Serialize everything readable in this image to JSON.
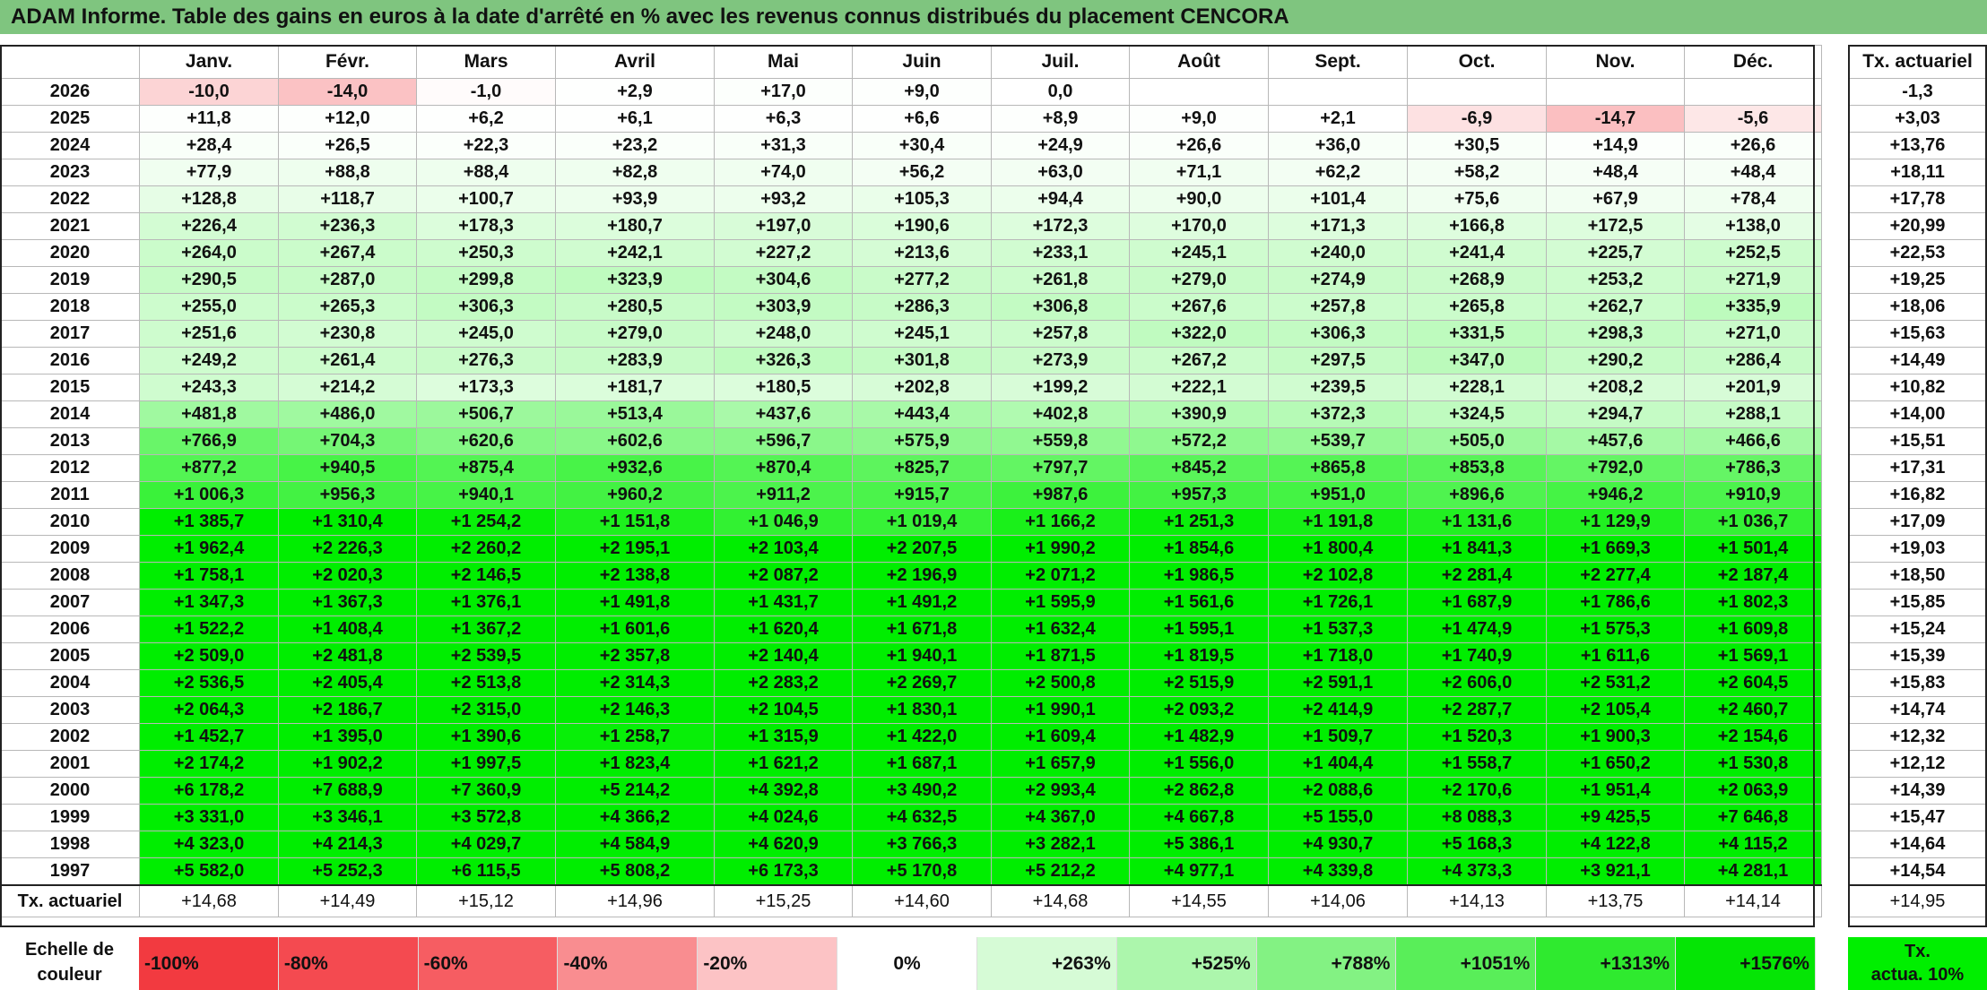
{
  "title": "ADAM Informe. Table des gains en euros à la date d'arrêté en % avec les revenus connus distribués du placement CENCORA",
  "months": [
    "Janv.",
    "Févr.",
    "Mars",
    "Avril",
    "Mai",
    "Juin",
    "Juil.",
    "Août",
    "Sept.",
    "Oct.",
    "Nov.",
    "Déc."
  ],
  "side_header": "Tx. actuariel",
  "rows": [
    {
      "year": "2026",
      "values": [
        "-10,0",
        "-14,0",
        "-1,0",
        "+2,9",
        "+17,0",
        "+9,0",
        "0,0",
        "",
        "",
        "",
        "",
        ""
      ],
      "tx": "-1,3"
    },
    {
      "year": "2025",
      "values": [
        "+11,8",
        "+12,0",
        "+6,2",
        "+6,1",
        "+6,3",
        "+6,6",
        "+8,9",
        "+9,0",
        "+2,1",
        "-6,9",
        "-14,7",
        "-5,6"
      ],
      "tx": "+3,03"
    },
    {
      "year": "2024",
      "values": [
        "+28,4",
        "+26,5",
        "+22,3",
        "+23,2",
        "+31,3",
        "+30,4",
        "+24,9",
        "+26,6",
        "+36,0",
        "+30,5",
        "+14,9",
        "+26,6"
      ],
      "tx": "+13,76"
    },
    {
      "year": "2023",
      "values": [
        "+77,9",
        "+88,8",
        "+88,4",
        "+82,8",
        "+74,0",
        "+56,2",
        "+63,0",
        "+71,1",
        "+62,2",
        "+58,2",
        "+48,4",
        "+48,4"
      ],
      "tx": "+18,11"
    },
    {
      "year": "2022",
      "values": [
        "+128,8",
        "+118,7",
        "+100,7",
        "+93,9",
        "+93,2",
        "+105,3",
        "+94,4",
        "+90,0",
        "+101,4",
        "+75,6",
        "+67,9",
        "+78,4"
      ],
      "tx": "+17,78"
    },
    {
      "year": "2021",
      "values": [
        "+226,4",
        "+236,3",
        "+178,3",
        "+180,7",
        "+197,0",
        "+190,6",
        "+172,3",
        "+170,0",
        "+171,3",
        "+166,8",
        "+172,5",
        "+138,0"
      ],
      "tx": "+20,99"
    },
    {
      "year": "2020",
      "values": [
        "+264,0",
        "+267,4",
        "+250,3",
        "+242,1",
        "+227,2",
        "+213,6",
        "+233,1",
        "+245,1",
        "+240,0",
        "+241,4",
        "+225,7",
        "+252,5"
      ],
      "tx": "+22,53"
    },
    {
      "year": "2019",
      "values": [
        "+290,5",
        "+287,0",
        "+299,8",
        "+323,9",
        "+304,6",
        "+277,2",
        "+261,8",
        "+279,0",
        "+274,9",
        "+268,9",
        "+253,2",
        "+271,9"
      ],
      "tx": "+19,25"
    },
    {
      "year": "2018",
      "values": [
        "+255,0",
        "+265,3",
        "+306,3",
        "+280,5",
        "+303,9",
        "+286,3",
        "+306,8",
        "+267,6",
        "+257,8",
        "+265,8",
        "+262,7",
        "+335,9"
      ],
      "tx": "+18,06"
    },
    {
      "year": "2017",
      "values": [
        "+251,6",
        "+230,8",
        "+245,0",
        "+279,0",
        "+248,0",
        "+245,1",
        "+257,8",
        "+322,0",
        "+306,3",
        "+331,5",
        "+298,3",
        "+271,0"
      ],
      "tx": "+15,63"
    },
    {
      "year": "2016",
      "values": [
        "+249,2",
        "+261,4",
        "+276,3",
        "+283,9",
        "+326,3",
        "+301,8",
        "+273,9",
        "+267,2",
        "+297,5",
        "+347,0",
        "+290,2",
        "+286,4"
      ],
      "tx": "+14,49"
    },
    {
      "year": "2015",
      "values": [
        "+243,3",
        "+214,2",
        "+173,3",
        "+181,7",
        "+180,5",
        "+202,8",
        "+199,2",
        "+222,1",
        "+239,5",
        "+228,1",
        "+208,2",
        "+201,9"
      ],
      "tx": "+10,82"
    },
    {
      "year": "2014",
      "values": [
        "+481,8",
        "+486,0",
        "+506,7",
        "+513,4",
        "+437,6",
        "+443,4",
        "+402,8",
        "+390,9",
        "+372,3",
        "+324,5",
        "+294,7",
        "+288,1"
      ],
      "tx": "+14,00"
    },
    {
      "year": "2013",
      "values": [
        "+766,9",
        "+704,3",
        "+620,6",
        "+602,6",
        "+596,7",
        "+575,9",
        "+559,8",
        "+572,2",
        "+539,7",
        "+505,0",
        "+457,6",
        "+466,6"
      ],
      "tx": "+15,51"
    },
    {
      "year": "2012",
      "values": [
        "+877,2",
        "+940,5",
        "+875,4",
        "+932,6",
        "+870,4",
        "+825,7",
        "+797,7",
        "+845,2",
        "+865,8",
        "+853,8",
        "+792,0",
        "+786,3"
      ],
      "tx": "+17,31"
    },
    {
      "year": "2011",
      "values": [
        "+1 006,3",
        "+956,3",
        "+940,1",
        "+960,2",
        "+911,2",
        "+915,7",
        "+987,6",
        "+957,3",
        "+951,0",
        "+896,6",
        "+946,2",
        "+910,9"
      ],
      "tx": "+16,82"
    },
    {
      "year": "2010",
      "values": [
        "+1 385,7",
        "+1 310,4",
        "+1 254,2",
        "+1 151,8",
        "+1 046,9",
        "+1 019,4",
        "+1 166,2",
        "+1 251,3",
        "+1 191,8",
        "+1 131,6",
        "+1 129,9",
        "+1 036,7"
      ],
      "tx": "+17,09"
    },
    {
      "year": "2009",
      "values": [
        "+1 962,4",
        "+2 226,3",
        "+2 260,2",
        "+2 195,1",
        "+2 103,4",
        "+2 207,5",
        "+1 990,2",
        "+1 854,6",
        "+1 800,4",
        "+1 841,3",
        "+1 669,3",
        "+1 501,4"
      ],
      "tx": "+19,03"
    },
    {
      "year": "2008",
      "values": [
        "+1 758,1",
        "+2 020,3",
        "+2 146,5",
        "+2 138,8",
        "+2 087,2",
        "+2 196,9",
        "+2 071,2",
        "+1 986,5",
        "+2 102,8",
        "+2 281,4",
        "+2 277,4",
        "+2 187,4"
      ],
      "tx": "+18,50"
    },
    {
      "year": "2007",
      "values": [
        "+1 347,3",
        "+1 367,3",
        "+1 376,1",
        "+1 491,8",
        "+1 431,7",
        "+1 491,2",
        "+1 595,9",
        "+1 561,6",
        "+1 726,1",
        "+1 687,9",
        "+1 786,6",
        "+1 802,3"
      ],
      "tx": "+15,85"
    },
    {
      "year": "2006",
      "values": [
        "+1 522,2",
        "+1 408,4",
        "+1 367,2",
        "+1 601,6",
        "+1 620,4",
        "+1 671,8",
        "+1 632,4",
        "+1 595,1",
        "+1 537,3",
        "+1 474,9",
        "+1 575,3",
        "+1 609,8"
      ],
      "tx": "+15,24"
    },
    {
      "year": "2005",
      "values": [
        "+2 509,0",
        "+2 481,8",
        "+2 539,5",
        "+2 357,8",
        "+2 140,4",
        "+1 940,1",
        "+1 871,5",
        "+1 819,5",
        "+1 718,0",
        "+1 740,9",
        "+1 611,6",
        "+1 569,1"
      ],
      "tx": "+15,39"
    },
    {
      "year": "2004",
      "values": [
        "+2 536,5",
        "+2 405,4",
        "+2 513,8",
        "+2 314,3",
        "+2 283,2",
        "+2 269,7",
        "+2 500,8",
        "+2 515,9",
        "+2 591,1",
        "+2 606,0",
        "+2 531,2",
        "+2 604,5"
      ],
      "tx": "+15,83"
    },
    {
      "year": "2003",
      "values": [
        "+2 064,3",
        "+2 186,7",
        "+2 315,0",
        "+2 146,3",
        "+2 104,5",
        "+1 830,1",
        "+1 990,1",
        "+2 093,2",
        "+2 414,9",
        "+2 287,7",
        "+2 105,4",
        "+2 460,7"
      ],
      "tx": "+14,74"
    },
    {
      "year": "2002",
      "values": [
        "+1 452,7",
        "+1 395,0",
        "+1 390,6",
        "+1 258,7",
        "+1 315,9",
        "+1 422,0",
        "+1 609,4",
        "+1 482,9",
        "+1 509,7",
        "+1 520,3",
        "+1 900,3",
        "+2 154,6"
      ],
      "tx": "+12,32"
    },
    {
      "year": "2001",
      "values": [
        "+2 174,2",
        "+1 902,2",
        "+1 997,5",
        "+1 823,4",
        "+1 621,2",
        "+1 687,1",
        "+1 657,9",
        "+1 556,0",
        "+1 404,4",
        "+1 558,7",
        "+1 650,2",
        "+1 530,8"
      ],
      "tx": "+12,12"
    },
    {
      "year": "2000",
      "values": [
        "+6 178,2",
        "+7 688,9",
        "+7 360,9",
        "+5 214,2",
        "+4 392,8",
        "+3 490,2",
        "+2 993,4",
        "+2 862,8",
        "+2 088,6",
        "+2 170,6",
        "+1 951,4",
        "+2 063,9"
      ],
      "tx": "+14,39"
    },
    {
      "year": "1999",
      "values": [
        "+3 331,0",
        "+3 346,1",
        "+3 572,8",
        "+4 366,2",
        "+4 024,6",
        "+4 632,5",
        "+4 367,0",
        "+4 667,8",
        "+5 155,0",
        "+8 088,3",
        "+9 425,5",
        "+7 646,8"
      ],
      "tx": "+15,47"
    },
    {
      "year": "1998",
      "values": [
        "+4 323,0",
        "+4 214,3",
        "+4 029,7",
        "+4 584,9",
        "+4 620,9",
        "+3 766,3",
        "+3 282,1",
        "+5 386,1",
        "+4 930,7",
        "+5 168,3",
        "+4 122,8",
        "+4 115,2"
      ],
      "tx": "+14,64"
    },
    {
      "year": "1997",
      "values": [
        "+5 582,0",
        "+5 252,3",
        "+6 115,5",
        "+5 808,2",
        "+6 173,3",
        "+5 170,8",
        "+5 212,2",
        "+4 977,1",
        "+4 339,8",
        "+4 373,3",
        "+3 921,1",
        "+4 281,1"
      ],
      "tx": "+14,54"
    }
  ],
  "footer": {
    "label": "Tx. actuariel",
    "values": [
      "+14,68",
      "+14,49",
      "+15,12",
      "+14,96",
      "+15,25",
      "+14,60",
      "+14,68",
      "+14,55",
      "+14,06",
      "+14,13",
      "+13,75",
      "+14,14"
    ],
    "tx": "+14,95"
  },
  "scale": {
    "label": "Echelle de couleur",
    "items": [
      {
        "text": "-100%",
        "color": "#f23a40",
        "align": "l"
      },
      {
        "text": "-80%",
        "color": "#f44a50",
        "align": "l"
      },
      {
        "text": "-60%",
        "color": "#f65d62",
        "align": "l"
      },
      {
        "text": "-40%",
        "color": "#f98d90",
        "align": "l"
      },
      {
        "text": "-20%",
        "color": "#fcc3c5",
        "align": "l"
      },
      {
        "text": "0%",
        "color": "#ffffff",
        "align": "c"
      },
      {
        "text": "+263%",
        "color": "#d6fbd6",
        "align": "r"
      },
      {
        "text": "+525%",
        "color": "#acf6ac",
        "align": "r"
      },
      {
        "text": "+788%",
        "color": "#83f283",
        "align": "r"
      },
      {
        "text": "+1051%",
        "color": "#59ee59",
        "align": "r"
      },
      {
        "text": "+1313%",
        "color": "#2fea2f",
        "align": "r"
      },
      {
        "text": "+1576%",
        "color": "#05e505",
        "align": "r"
      }
    ],
    "side_label_1": "Tx.",
    "side_label_2": "actua. 10%",
    "side_color": "#00ef00"
  }
}
